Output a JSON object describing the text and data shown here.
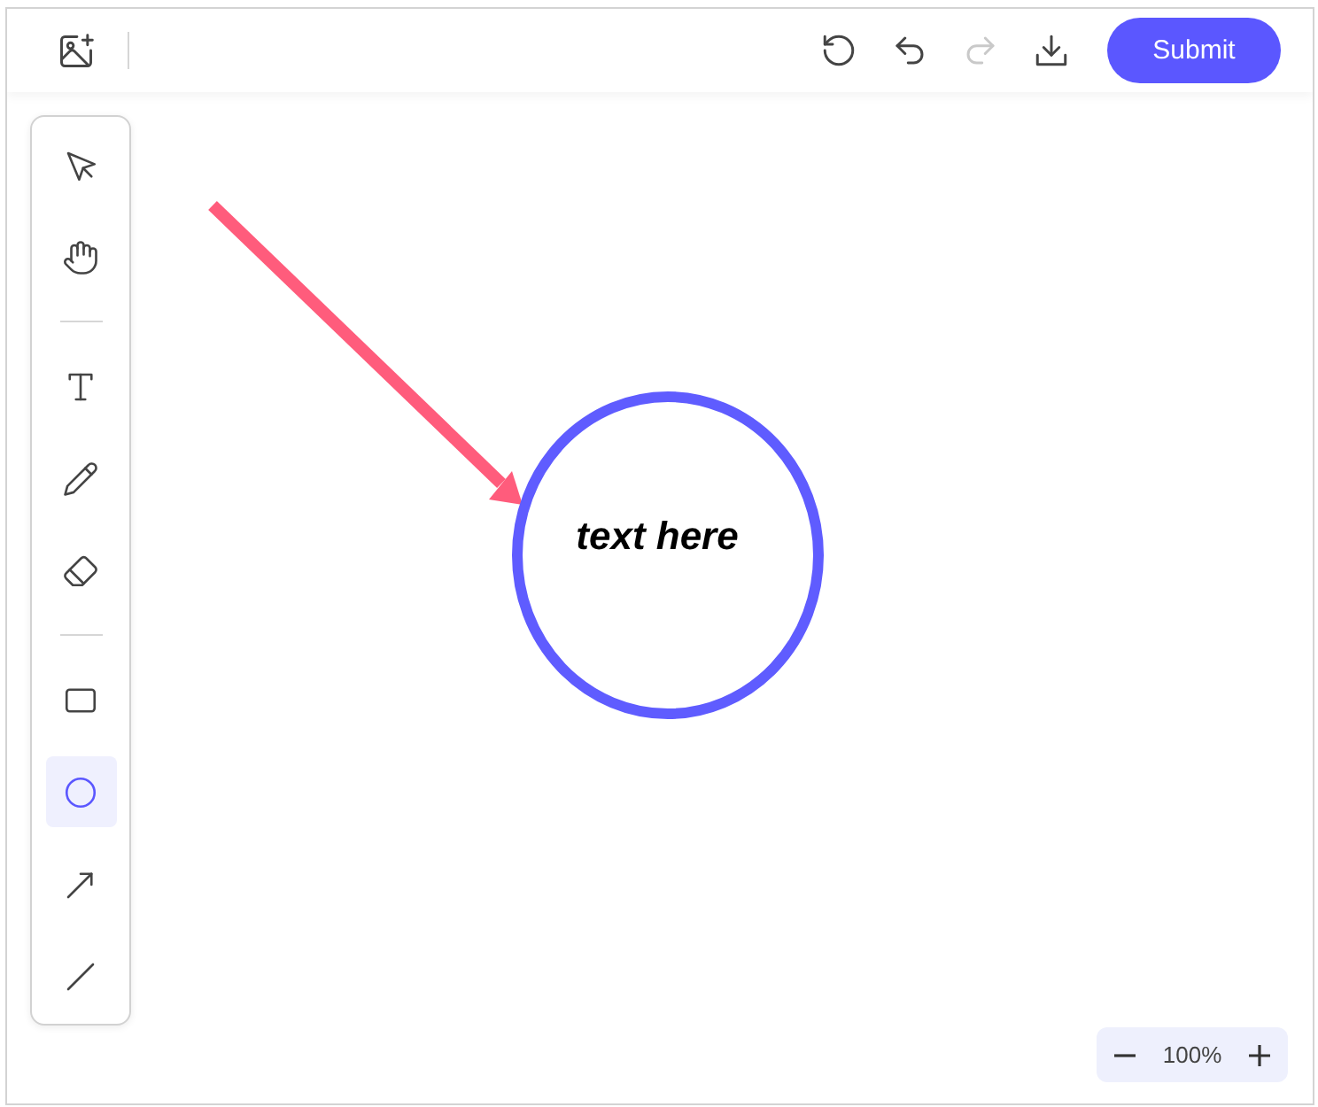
{
  "toolbar": {
    "actions": [
      {
        "kind": "reset",
        "disabled": false
      },
      {
        "kind": "undo",
        "disabled": false
      },
      {
        "kind": "redo",
        "disabled": true
      },
      {
        "kind": "download",
        "disabled": false
      }
    ],
    "submit": "Submit"
  },
  "tool_groups": [
    {
      "tools": [
        {
          "kind": "select",
          "selected": false
        },
        {
          "kind": "hand",
          "selected": false
        }
      ]
    },
    {
      "tools": [
        {
          "kind": "text",
          "selected": false
        },
        {
          "kind": "pencil",
          "selected": false
        },
        {
          "kind": "eraser",
          "selected": false
        }
      ]
    },
    {
      "tools": [
        {
          "kind": "rectangle",
          "selected": false
        },
        {
          "kind": "ellipse",
          "selected": true
        },
        {
          "kind": "arrow",
          "selected": false
        },
        {
          "kind": "line",
          "selected": false
        }
      ]
    }
  ],
  "canvas": {
    "shapes": [
      {
        "kind": "arrow",
        "color": "#ff5c7c"
      },
      {
        "kind": "ellipse",
        "color": "#5f5cff",
        "text": "text here"
      }
    ]
  },
  "zoom": {
    "label": "100%"
  }
}
